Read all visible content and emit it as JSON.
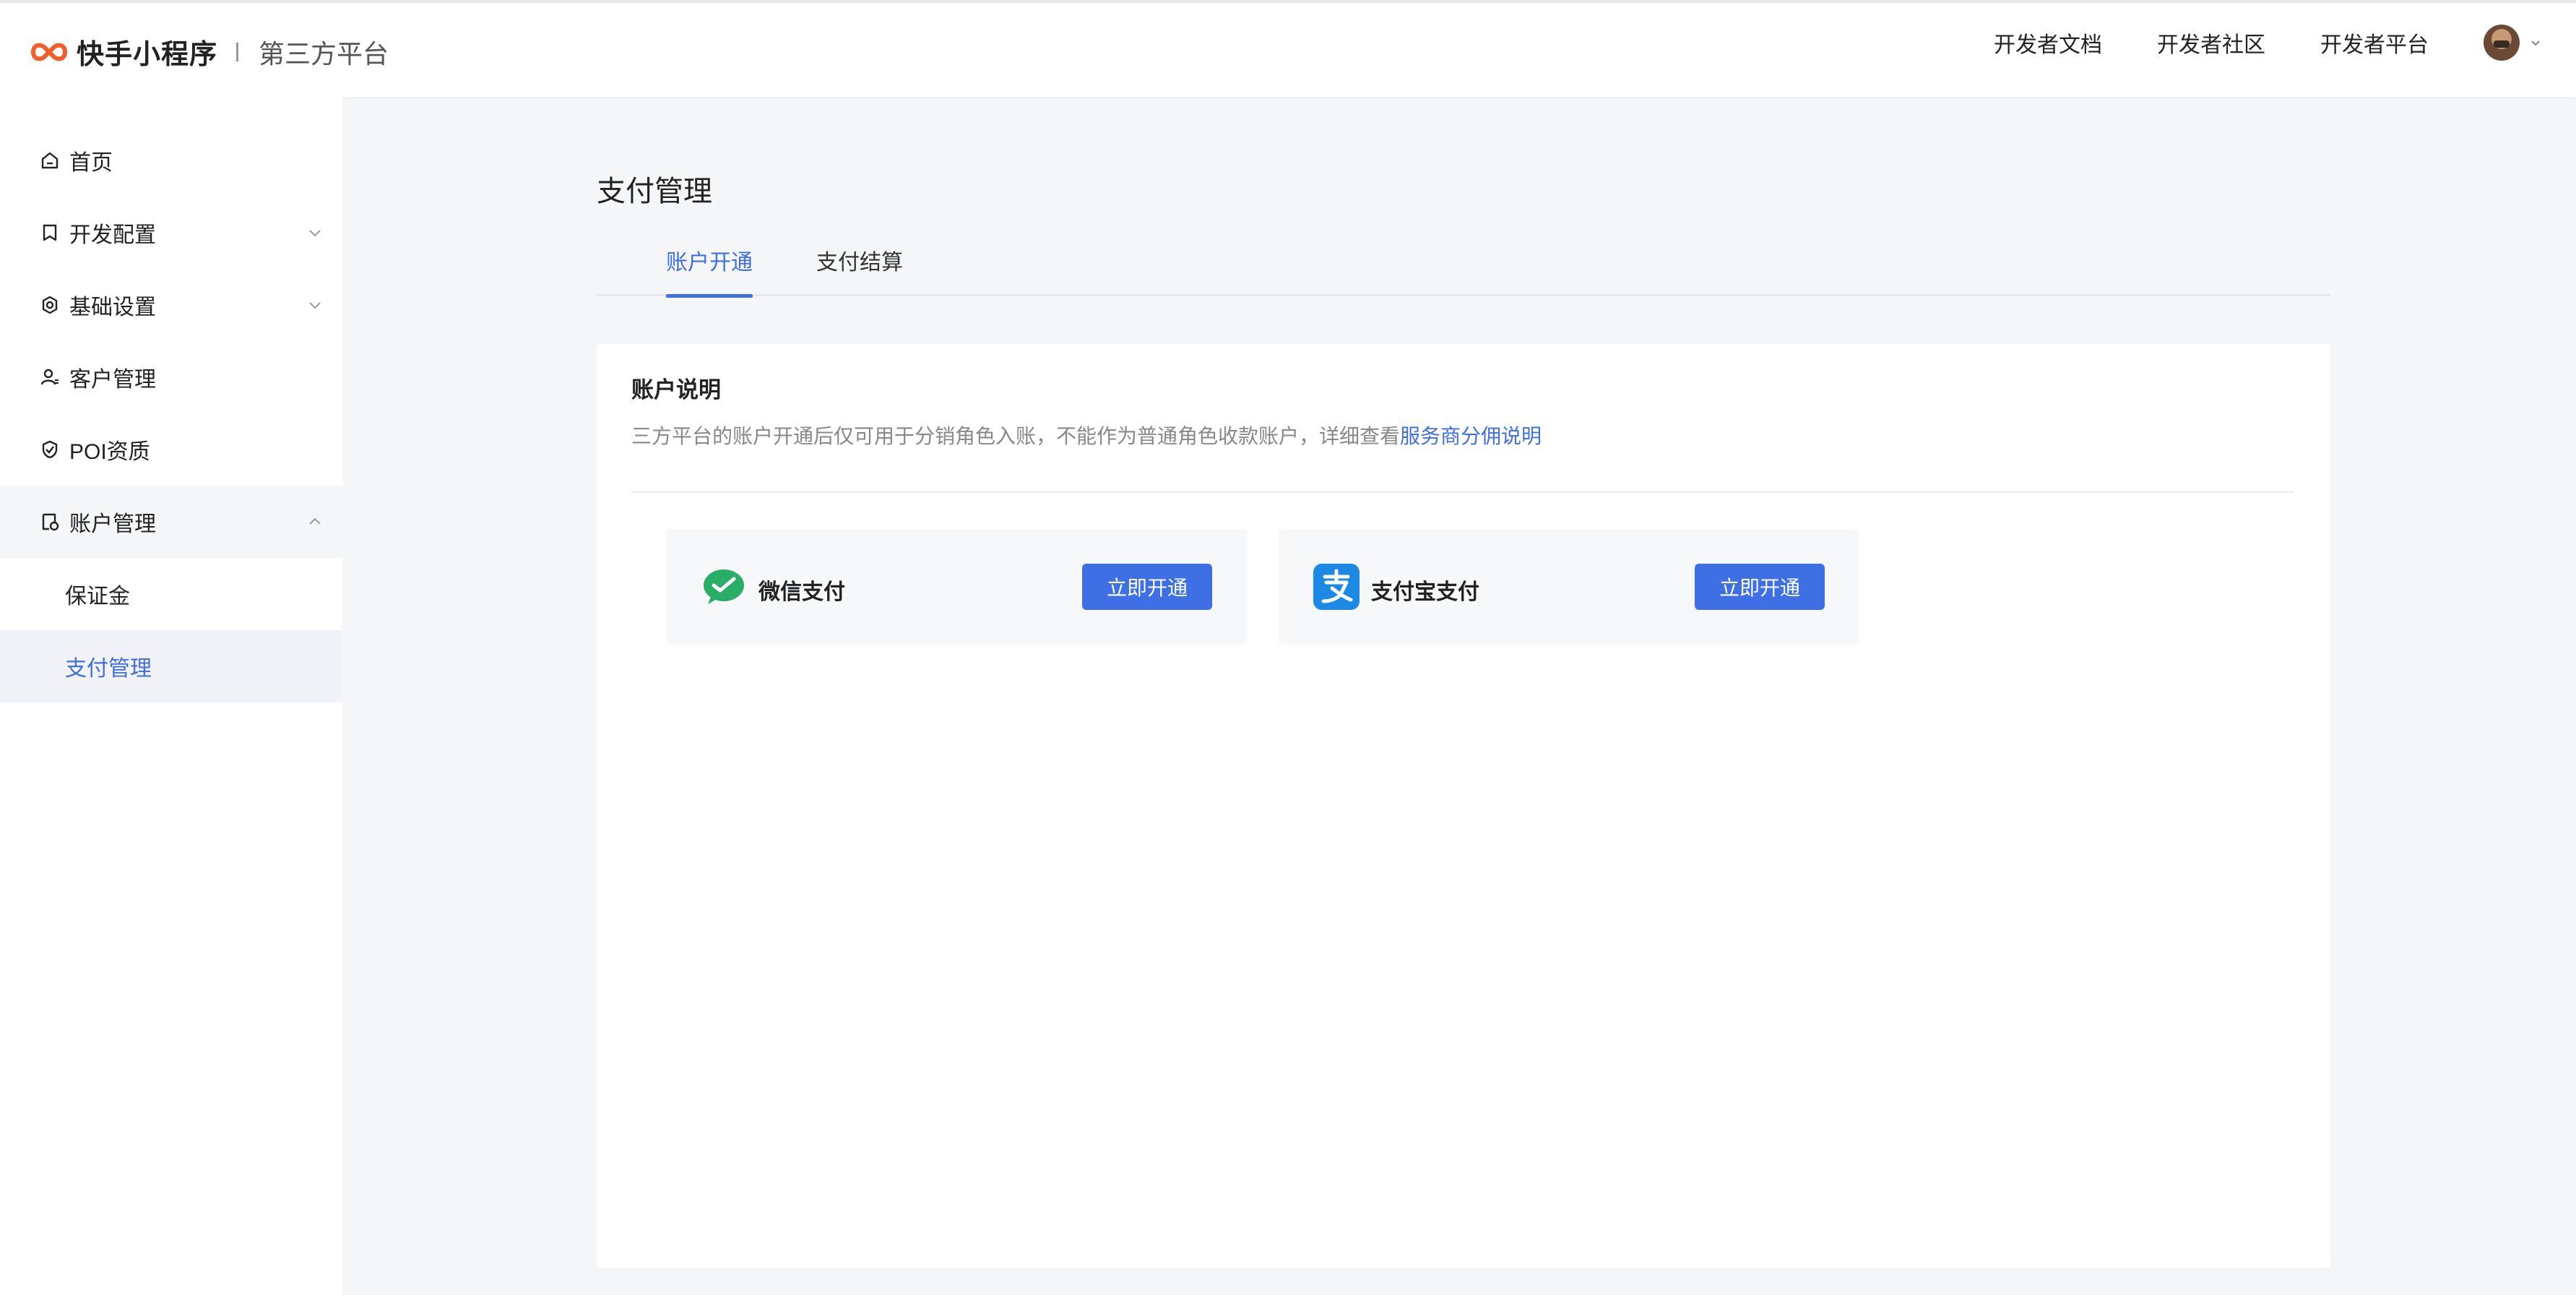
{
  "header": {
    "brand": "快手小程序",
    "sub_brand": "第三方平台",
    "links": [
      "开发者文档",
      "开发者社区",
      "开发者平台"
    ]
  },
  "sidebar": {
    "items": [
      {
        "label": "首页"
      },
      {
        "label": "开发配置"
      },
      {
        "label": "基础设置"
      },
      {
        "label": "客户管理"
      },
      {
        "label": "POI资质"
      },
      {
        "label": "账户管理"
      }
    ],
    "sub_items": [
      {
        "label": "保证金"
      },
      {
        "label": "支付管理"
      }
    ]
  },
  "main": {
    "title": "支付管理",
    "tabs": [
      {
        "label": "账户开通"
      },
      {
        "label": "支付结算"
      }
    ],
    "card": {
      "title": "账户说明",
      "desc": "三方平台的账户开通后仅可用于分销角色入账，不能作为普通角色收款账户，详细查看",
      "link": "服务商分佣说明"
    },
    "payments": [
      {
        "name": "微信支付",
        "button": "立即开通"
      },
      {
        "name": "支付宝支付",
        "button": "立即开通"
      }
    ]
  },
  "colors": {
    "accent": "#3e6fe4",
    "brand_orange": "#f25e2a",
    "wechat_green": "#2aae67",
    "alipay_blue": "#1e88e5"
  }
}
